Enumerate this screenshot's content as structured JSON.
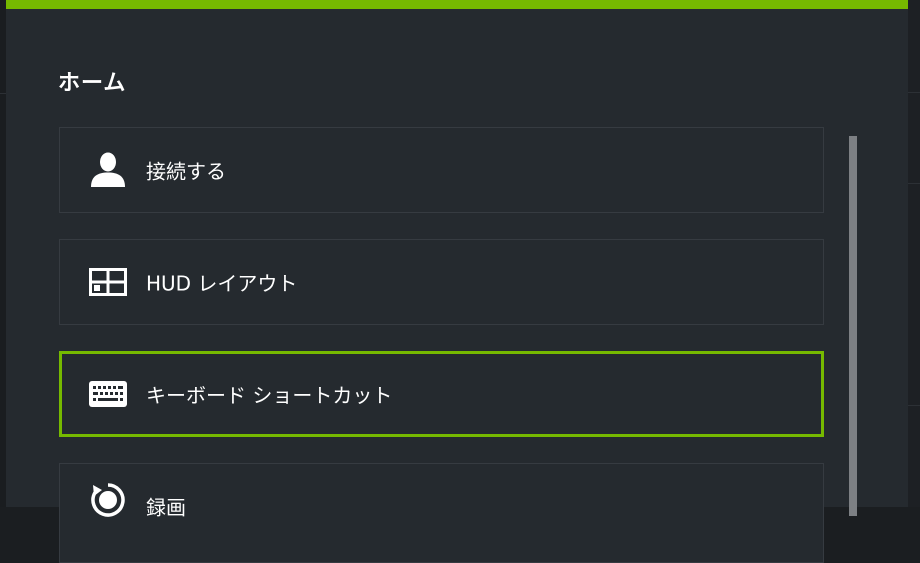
{
  "panel": {
    "title": "ホーム",
    "accent_color": "#76b900"
  },
  "menu": {
    "items": [
      {
        "label": "接続する",
        "icon": "user-icon",
        "selected": false
      },
      {
        "label": "HUD レイアウト",
        "icon": "layout-grid-icon",
        "selected": false
      },
      {
        "label": "キーボード ショートカット",
        "icon": "keyboard-icon",
        "selected": true
      },
      {
        "label": "録画",
        "icon": "record-icon",
        "selected": false
      }
    ]
  }
}
